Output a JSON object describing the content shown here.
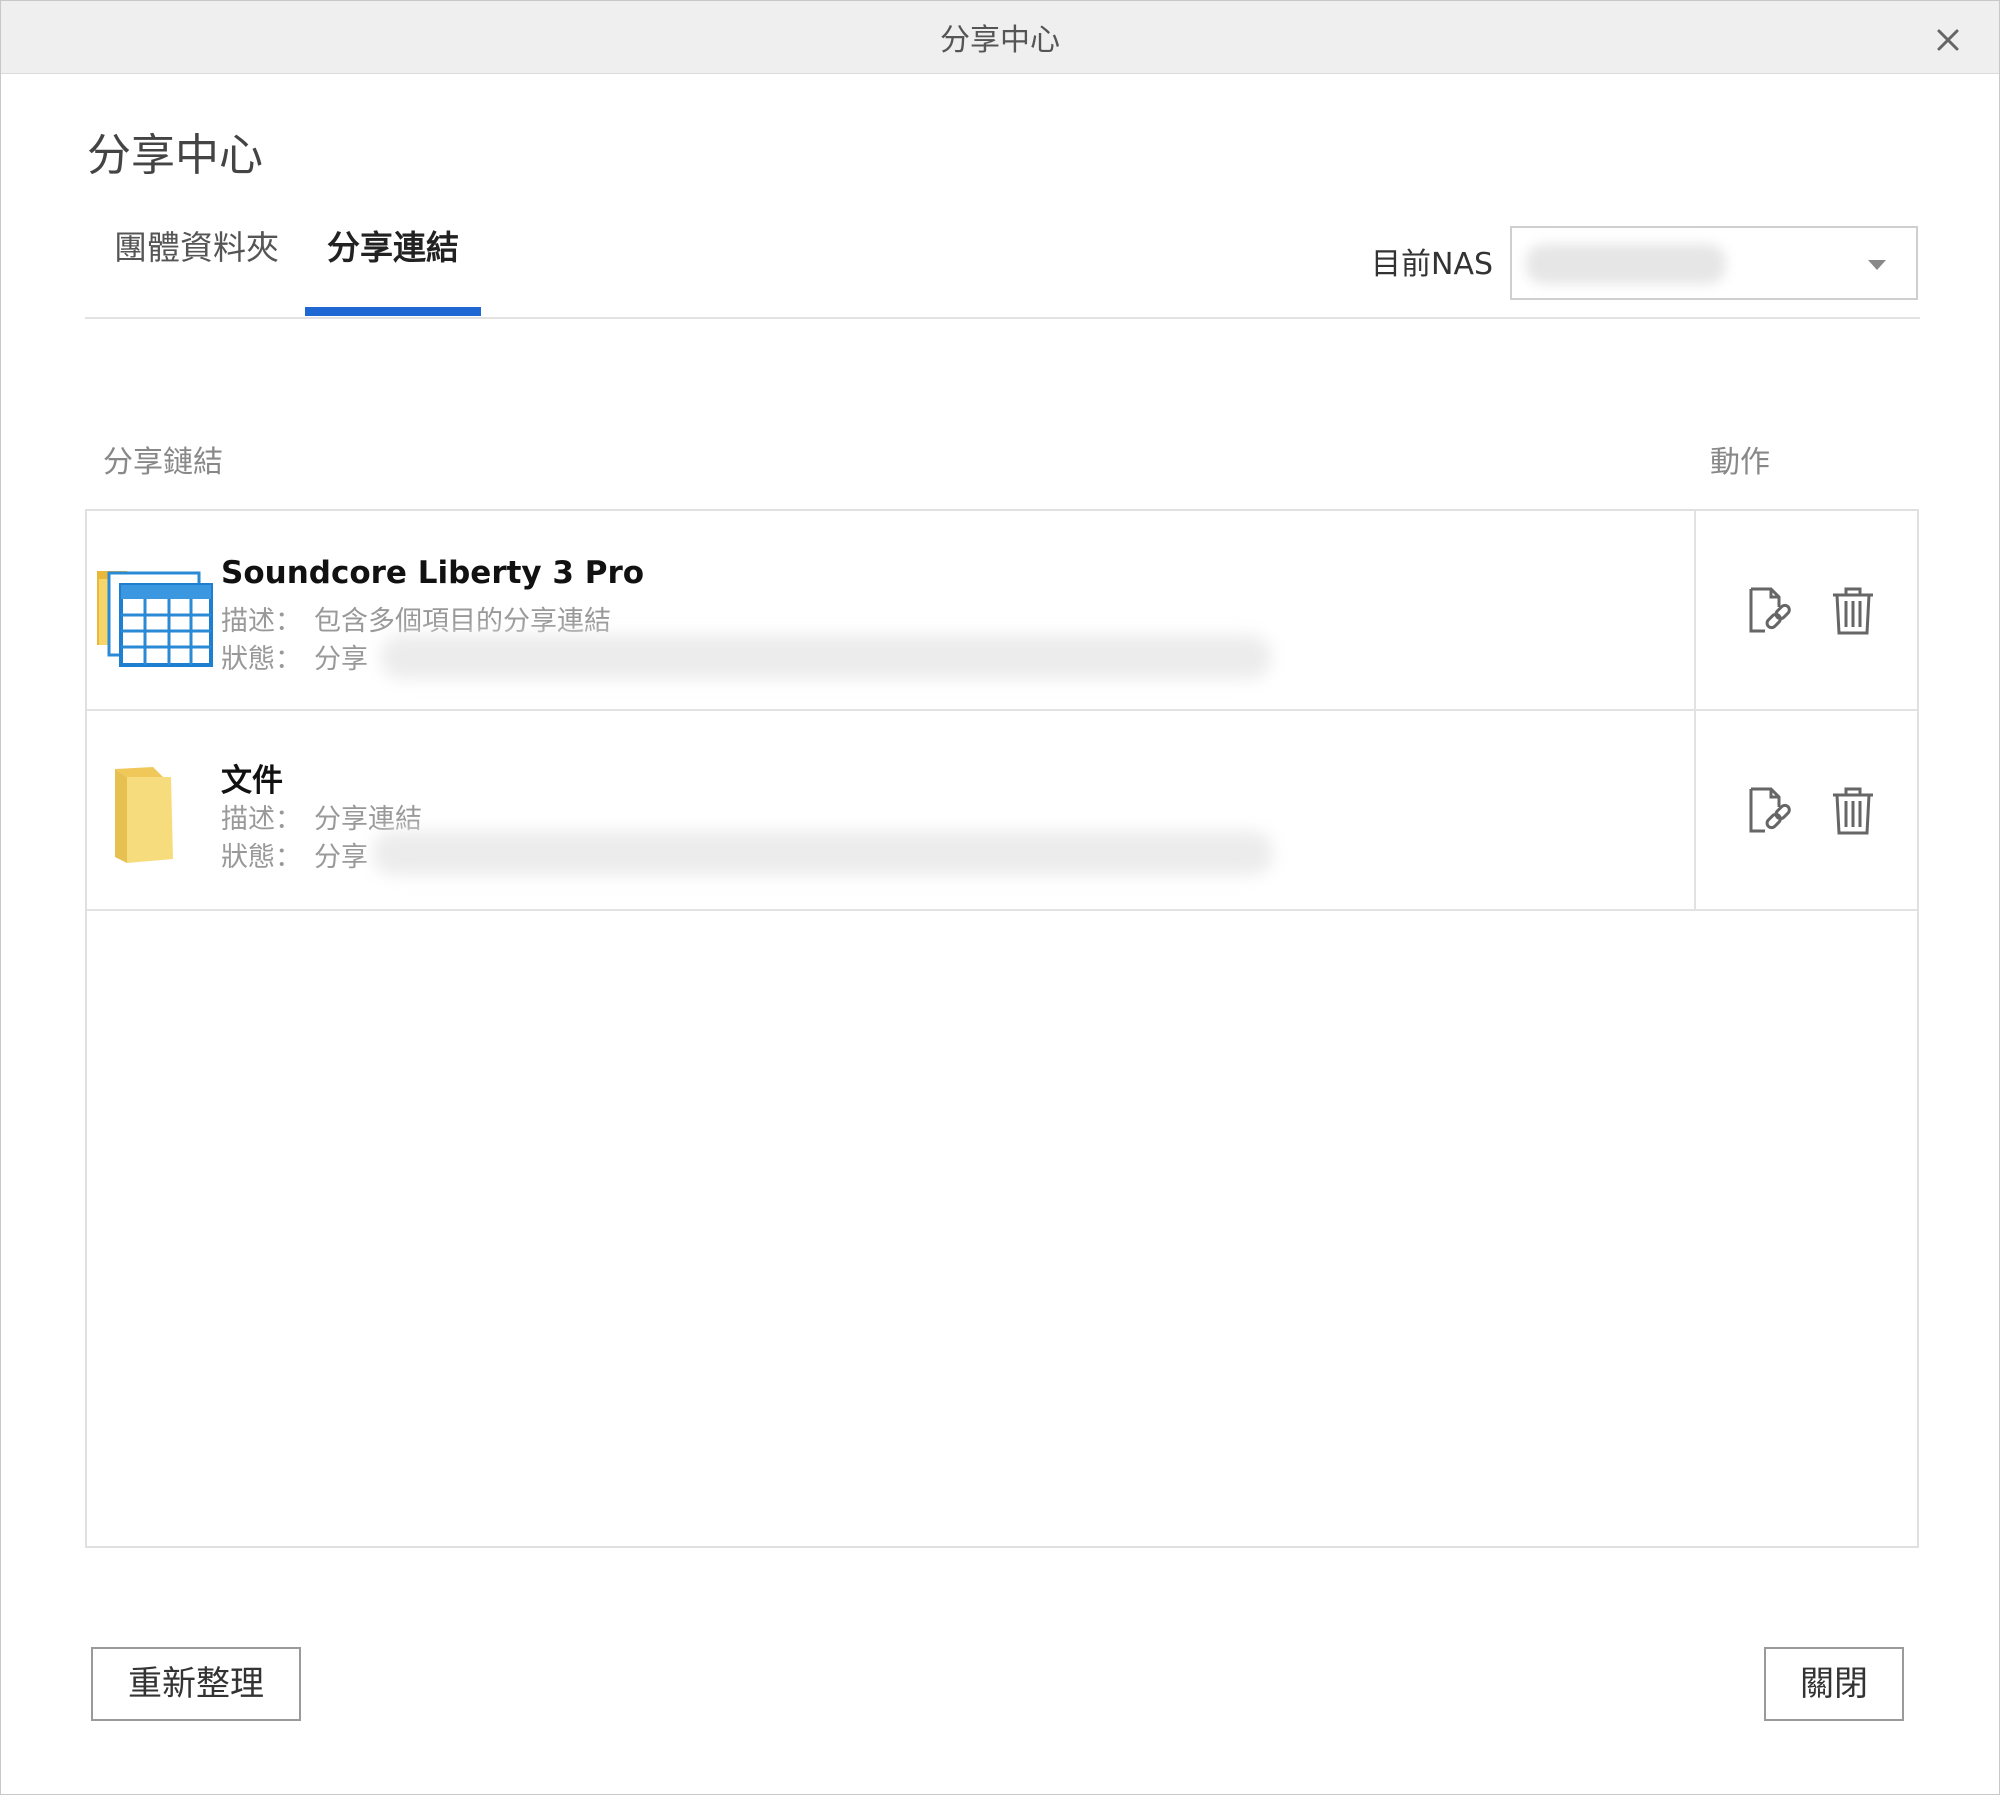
{
  "window": {
    "title": "分享中心"
  },
  "header": {
    "title": "分享中心"
  },
  "tabs": [
    {
      "label": "團體資料夾",
      "active": false
    },
    {
      "label": "分享連結",
      "active": true
    }
  ],
  "nas": {
    "label": "目前NAS",
    "selected": ""
  },
  "table": {
    "columns": {
      "link": "分享鏈結",
      "action": "動作"
    },
    "rows": [
      {
        "name": "Soundcore Liberty 3 Pro",
        "desc_label": "描述：",
        "desc": "包含多個項目的分享連結",
        "status_label": "狀態：",
        "status": "分享",
        "icon": "multi-file-icon"
      },
      {
        "name": "文件",
        "desc_label": "描述：",
        "desc": "分享連結",
        "status_label": "狀態：",
        "status": "分享",
        "icon": "folder-icon"
      }
    ]
  },
  "footer": {
    "refresh_label": "重新整理",
    "close_label": "關閉"
  },
  "colors": {
    "accent": "#1f67d2",
    "folder": "#f6d56b",
    "border": "#e0e0e0"
  }
}
